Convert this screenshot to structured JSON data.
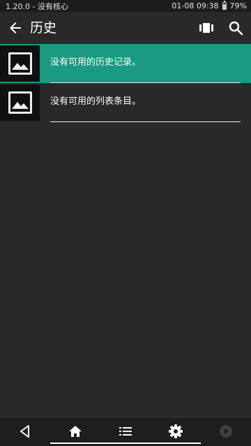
{
  "status_bar": {
    "left_text": "1.20.0 - 没有核心",
    "datetime": "01-08 09:38",
    "battery_percent": "79%",
    "battery_level": 0.79
  },
  "app_bar": {
    "title": "历史"
  },
  "icons": {
    "back": "arrow-left-icon",
    "view_toggle": "view-carousel-icon",
    "search": "search-icon",
    "thumbnail": "image-placeholder-icon",
    "nav_back": "triangle-back-icon",
    "nav_home": "home-icon",
    "nav_list": "list-icon",
    "nav_settings": "gear-icon",
    "nav_play": "play-circle-icon"
  },
  "list": {
    "items": [
      {
        "label": "没有可用的历史记录。",
        "selected": true
      },
      {
        "label": "没有可用的列表条目。",
        "selected": false
      }
    ]
  },
  "colors": {
    "background": "#292929",
    "accent": "#1a9a80",
    "status_bar": "#1c1c1c",
    "bottom_bar": "#1e1e1e"
  }
}
